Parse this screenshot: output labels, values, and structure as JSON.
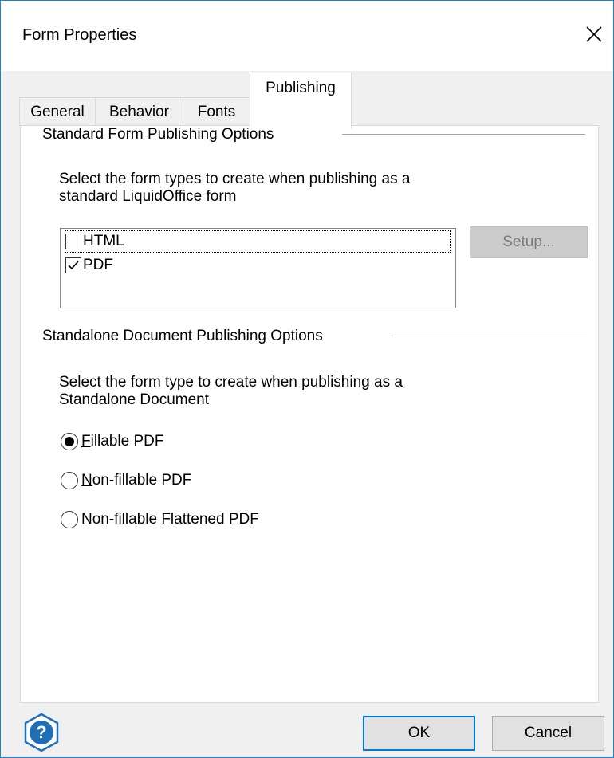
{
  "window": {
    "title": "Form Properties",
    "close_symbol": "✕"
  },
  "tabs": [
    {
      "label": "General",
      "active": false
    },
    {
      "label": "Behavior",
      "active": false
    },
    {
      "label": "Fonts",
      "active": false
    },
    {
      "label": "Publishing",
      "active": true
    }
  ],
  "standard": {
    "group_title": "Standard Form Publishing Options",
    "description_line1": "Select the form types to create when publishing as a",
    "description_line2": "standard LiquidOffice form",
    "items": [
      {
        "label": "HTML",
        "checked": false,
        "focused": true
      },
      {
        "label": "PDF",
        "checked": true,
        "focused": false
      }
    ],
    "setup_label": "Setup...",
    "setup_enabled": false
  },
  "standalone": {
    "group_title": "Standalone Document Publishing Options",
    "description_line1": "Select the form type to create when publishing as a",
    "description_line2": "Standalone Document",
    "options": [
      {
        "label": "Fillable PDF",
        "selected": true
      },
      {
        "label": "Non-fillable PDF",
        "selected": false
      },
      {
        "label": "Non-fillable Flattened PDF",
        "selected": false
      }
    ]
  },
  "footer": {
    "help_symbol": "?",
    "ok_label": "OK",
    "cancel_label": "Cancel"
  },
  "colors": {
    "accent": "#0078d7",
    "window_border": "#1883d7",
    "help_icon": "#1e6fb8"
  }
}
